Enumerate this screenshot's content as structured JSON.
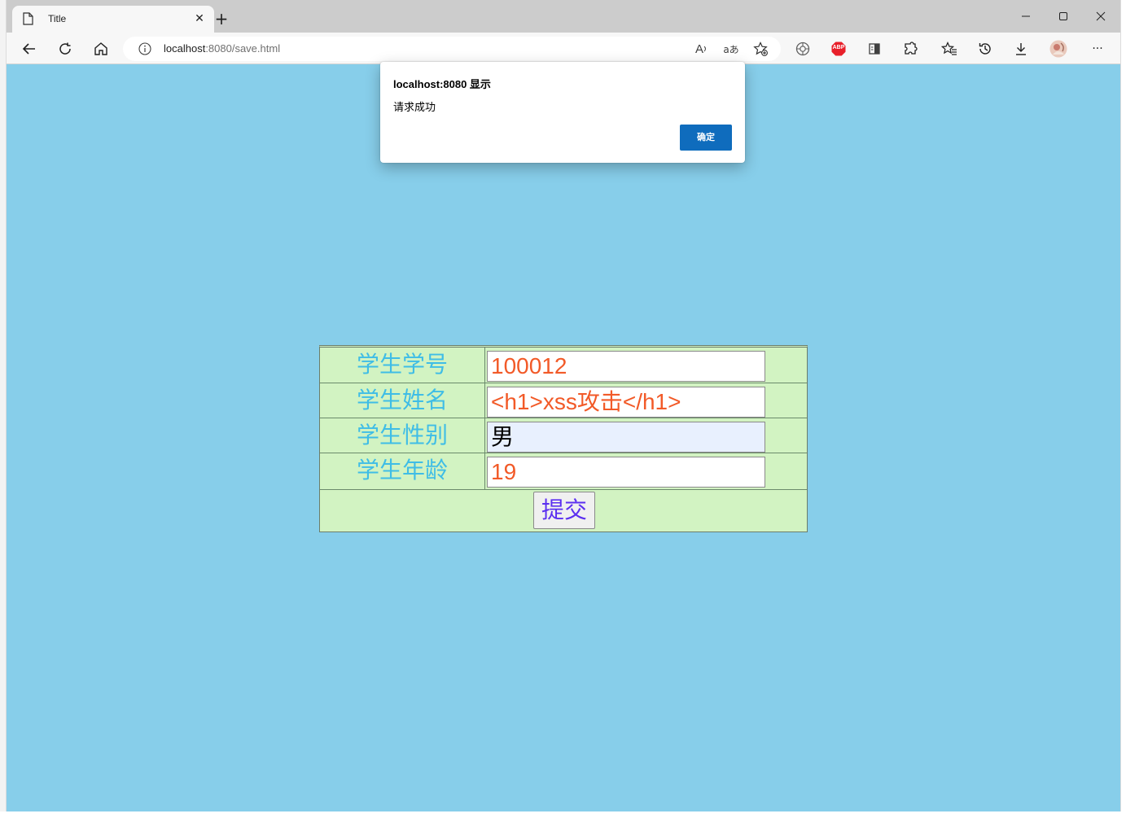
{
  "browser": {
    "tab": {
      "title": "Title"
    },
    "url": {
      "host": "localhost",
      "path": ":8080/save.html"
    },
    "toolbar_icons": [
      "back-icon",
      "refresh-icon",
      "home-icon",
      "info-icon",
      "read-aloud-icon",
      "translate-icon",
      "add-favorite-icon",
      "extension-icon",
      "adblock-icon",
      "reading-list-icon",
      "extensions-icon",
      "favorites-icon",
      "history-icon",
      "download-icon",
      "profile-avatar",
      "more-icon"
    ],
    "adblock_label": "ABP",
    "read_aloud_label": "A",
    "translate_label": "aあ",
    "more_label": "···"
  },
  "dialog": {
    "title": "localhost:8080 显示",
    "message": "请求成功",
    "ok_label": "确定"
  },
  "form": {
    "rows": [
      {
        "label": "学生学号",
        "value": "100012"
      },
      {
        "label": "学生姓名",
        "value": "<h1>xss攻击</h1>"
      },
      {
        "label": "学生性别",
        "value": "男"
      },
      {
        "label": "学生年龄",
        "value": "19"
      }
    ],
    "submit_label": "提交"
  },
  "colors": {
    "page_background": "#87ceea",
    "table_background": "#d2f3c2",
    "label_color": "#3fbde6",
    "input_text_color": "#f25a28",
    "submit_text_color": "#5b2ff0",
    "dialog_button": "#0f6cbd"
  }
}
